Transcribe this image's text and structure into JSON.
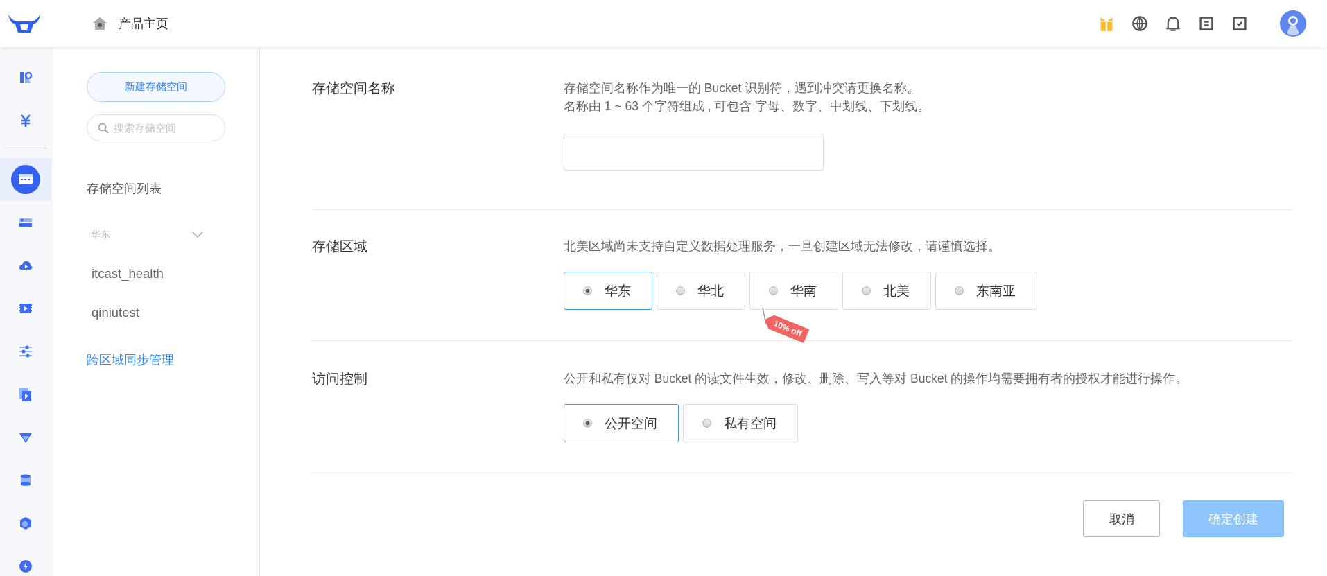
{
  "header": {
    "title": "产品主页"
  },
  "rail_items": [
    {
      "selected": false
    },
    {
      "selected": false
    },
    {
      "selected": true
    },
    {
      "selected": false
    },
    {
      "selected": false
    },
    {
      "selected": false
    },
    {
      "selected": false
    },
    {
      "selected": false
    },
    {
      "selected": false
    },
    {
      "selected": false
    },
    {
      "selected": false
    },
    {
      "selected": false
    }
  ],
  "sidebar": {
    "new_button": "新建存储空间",
    "search": {
      "placeholder": "搜索存储空间"
    },
    "list_title": "存储空间列表",
    "region": {
      "label": "华东",
      "expanded": true
    },
    "buckets": [
      "itcast_health",
      "qiniutest"
    ],
    "link": "跨区域同步管理"
  },
  "sections": [
    {
      "kind": "text-input",
      "label": "存储空间名称",
      "description": [
        "存储空间名称作为唯一的 Bucket 识别符，遇到冲突请更换名称。",
        "名称由 1 ~ 63 个字符组成 , 可包含 字母、数字、中划线、下划线。"
      ]
    },
    {
      "kind": "choice",
      "label": "存储区域",
      "description": [
        "北美区域尚未支持自定义数据处理服务，一旦创建区域无法修改，请谨慎选择。"
      ],
      "options": [
        {
          "label": "华东",
          "selected": true
        },
        {
          "label": "华北",
          "selected": false
        },
        {
          "label": "华南",
          "selected": false,
          "tag": "10% off"
        },
        {
          "label": "北美",
          "selected": false
        },
        {
          "label": "东南亚",
          "selected": false
        }
      ]
    },
    {
      "kind": "choice",
      "label": "访问控制",
      "description": [
        "公开和私有仅对 Bucket 的读文件生效，修改、删除、写入等对 Bucket 的操作均需要拥有者的授权才能进行操作。"
      ],
      "options": [
        {
          "label": "公开空间",
          "selected": true
        },
        {
          "label": "私有空间",
          "selected": false
        }
      ]
    }
  ],
  "footer": {
    "buttons": [
      {
        "label": "取消",
        "kind": "secondary",
        "disabled": false
      },
      {
        "label": "确定创建",
        "kind": "primary",
        "disabled": true
      }
    ]
  }
}
